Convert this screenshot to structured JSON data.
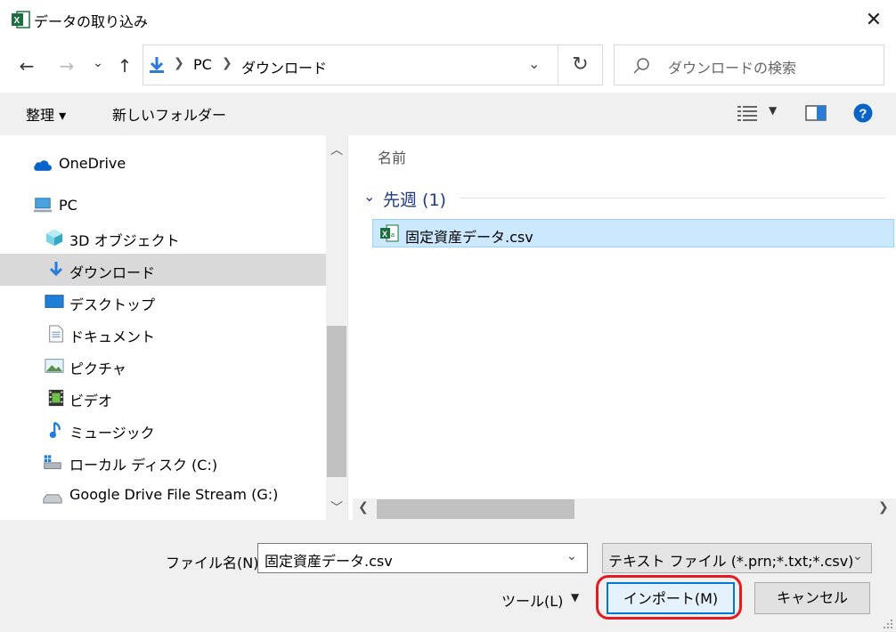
{
  "window": {
    "title": "データの取り込み",
    "close_glyph": "✕"
  },
  "nav": {
    "back_glyph": "←",
    "forward_glyph": "→",
    "recent_glyph": "⌄",
    "up_glyph": "↑",
    "breadcrumb": [
      "PC",
      "ダウンロード"
    ],
    "refresh_glyph": "↻",
    "search_placeholder": "ダウンロードの検索"
  },
  "toolbar": {
    "organize_label": "整理 ▾",
    "new_folder_label": "新しいフォルダー",
    "help_glyph": "?"
  },
  "sidebar": {
    "items": [
      {
        "label": "OneDrive",
        "icon": "cloud-icon"
      },
      {
        "label": "PC",
        "icon": "computer-icon"
      },
      {
        "label": "3D オブジェクト",
        "icon": "cube-icon"
      },
      {
        "label": "ダウンロード",
        "icon": "download-icon"
      },
      {
        "label": "デスクトップ",
        "icon": "desktop-icon"
      },
      {
        "label": "ドキュメント",
        "icon": "document-icon"
      },
      {
        "label": "ピクチャ",
        "icon": "picture-icon"
      },
      {
        "label": "ビデオ",
        "icon": "video-icon"
      },
      {
        "label": "ミュージック",
        "icon": "music-icon"
      },
      {
        "label": "ローカル ディスク (C:)",
        "icon": "disk-icon"
      },
      {
        "label": "Google Drive File Stream (G:)",
        "icon": "drive-icon"
      }
    ]
  },
  "content": {
    "column_name": "名前",
    "group": "先週 (1)",
    "files": [
      {
        "name": "固定資産データ.csv",
        "icon": "excel-csv-icon"
      }
    ]
  },
  "footer": {
    "filename_label": "ファイル名(N):",
    "filename_value": "固定資産データ.csv",
    "filter_value": "テキスト ファイル (*.prn;*.txt;*.csv)",
    "tools_label": "ツール(L)",
    "import_label": "インポート(M)",
    "cancel_label": "キャンセル"
  },
  "colors": {
    "accent": "#0078d7",
    "selection": "#cce8ff",
    "highlight_ring": "#e31b23",
    "excel_green": "#1d6f42"
  }
}
